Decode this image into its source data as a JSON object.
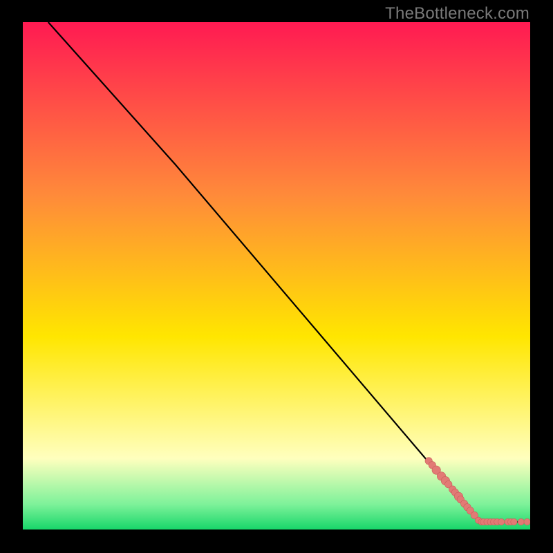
{
  "watermark": "TheBottleneck.com",
  "colors": {
    "bg_black": "#000000",
    "line": "#000000",
    "marker_fill": "#e27a75",
    "marker_stroke": "#c95f5a",
    "grad_top": "#ff1a52",
    "grad_mid_orange": "#ff8a3a",
    "grad_yellow": "#ffe600",
    "grad_pale_yellow": "#ffffbe",
    "grad_green_light": "#7ef29a",
    "grad_green": "#18d66a"
  },
  "chart_data": {
    "type": "line",
    "title": "",
    "xlabel": "",
    "ylabel": "",
    "xlim": [
      0,
      100
    ],
    "ylim": [
      0,
      100
    ],
    "curve": [
      {
        "x": 5,
        "y": 100
      },
      {
        "x": 30,
        "y": 72
      },
      {
        "x": 90,
        "y": 1.5
      },
      {
        "x": 100,
        "y": 1.5
      }
    ],
    "markers": [
      {
        "x": 80.0,
        "y": 13.5,
        "r": 1.0
      },
      {
        "x": 80.7,
        "y": 12.7,
        "r": 1.0
      },
      {
        "x": 81.5,
        "y": 11.7,
        "r": 1.2
      },
      {
        "x": 82.5,
        "y": 10.5,
        "r": 1.2
      },
      {
        "x": 83.3,
        "y": 9.6,
        "r": 1.2
      },
      {
        "x": 83.9,
        "y": 8.9,
        "r": 1.0
      },
      {
        "x": 84.7,
        "y": 7.9,
        "r": 1.0
      },
      {
        "x": 85.2,
        "y": 7.3,
        "r": 1.0
      },
      {
        "x": 85.9,
        "y": 6.5,
        "r": 1.2
      },
      {
        "x": 86.3,
        "y": 5.9,
        "r": 1.0
      },
      {
        "x": 87.0,
        "y": 5.1,
        "r": 1.0
      },
      {
        "x": 87.6,
        "y": 4.4,
        "r": 1.0
      },
      {
        "x": 88.2,
        "y": 3.7,
        "r": 1.0
      },
      {
        "x": 89.0,
        "y": 2.8,
        "r": 1.0
      },
      {
        "x": 89.8,
        "y": 1.8,
        "r": 0.9
      },
      {
        "x": 90.4,
        "y": 1.5,
        "r": 0.9
      },
      {
        "x": 90.8,
        "y": 1.5,
        "r": 0.9
      },
      {
        "x": 91.5,
        "y": 1.5,
        "r": 0.9
      },
      {
        "x": 92.2,
        "y": 1.5,
        "r": 0.9
      },
      {
        "x": 92.8,
        "y": 1.5,
        "r": 0.9
      },
      {
        "x": 93.5,
        "y": 1.5,
        "r": 0.9
      },
      {
        "x": 94.3,
        "y": 1.5,
        "r": 0.9
      },
      {
        "x": 95.6,
        "y": 1.5,
        "r": 0.9
      },
      {
        "x": 96.2,
        "y": 1.5,
        "r": 0.9
      },
      {
        "x": 96.8,
        "y": 1.5,
        "r": 0.9
      },
      {
        "x": 98.2,
        "y": 1.5,
        "r": 0.9
      },
      {
        "x": 99.4,
        "y": 1.5,
        "r": 0.9
      }
    ]
  }
}
